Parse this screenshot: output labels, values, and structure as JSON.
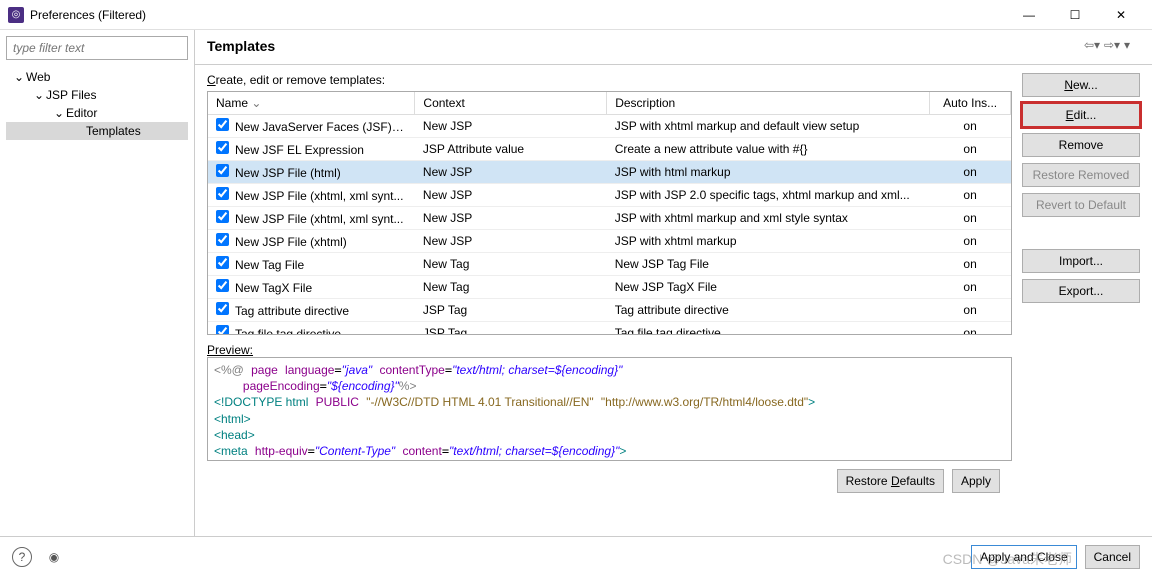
{
  "window": {
    "title": "Preferences (Filtered)"
  },
  "filter": {
    "placeholder": "type filter text"
  },
  "tree": {
    "items": [
      {
        "label": "Web",
        "level": 1,
        "caret": "⌄",
        "selected": false
      },
      {
        "label": "JSP Files",
        "level": 2,
        "caret": "⌄",
        "selected": false
      },
      {
        "label": "Editor",
        "level": 3,
        "caret": "⌄",
        "selected": false
      },
      {
        "label": "Templates",
        "level": 4,
        "caret": "",
        "selected": true
      }
    ]
  },
  "page": {
    "title": "Templates",
    "desc_prefix": "C",
    "desc_rest": "reate, edit or remove templates:"
  },
  "table": {
    "headers": {
      "name": "Name",
      "context": "Context",
      "description": "Description",
      "auto": "Auto Ins..."
    },
    "rows": [
      {
        "checked": true,
        "name": "New JavaServer Faces (JSF) P...",
        "context": "New JSP",
        "description": "JSP with xhtml markup and default view setup",
        "auto": "on",
        "selected": false
      },
      {
        "checked": true,
        "name": "New JSF EL Expression",
        "context": "JSP Attribute value",
        "description": "Create a new attribute value with #{}",
        "auto": "on",
        "selected": false
      },
      {
        "checked": true,
        "name": "New JSP File (html)",
        "context": "New JSP",
        "description": "JSP with html markup",
        "auto": "on",
        "selected": true
      },
      {
        "checked": true,
        "name": "New JSP File (xhtml, xml synt...",
        "context": "New JSP",
        "description": "JSP with JSP 2.0 specific tags, xhtml markup and xml...",
        "auto": "on",
        "selected": false
      },
      {
        "checked": true,
        "name": "New JSP File (xhtml, xml synt...",
        "context": "New JSP",
        "description": "JSP with xhtml markup and xml style syntax",
        "auto": "on",
        "selected": false
      },
      {
        "checked": true,
        "name": "New JSP File (xhtml)",
        "context": "New JSP",
        "description": "JSP with xhtml markup",
        "auto": "on",
        "selected": false
      },
      {
        "checked": true,
        "name": "New Tag File",
        "context": "New Tag",
        "description": "New JSP Tag File",
        "auto": "on",
        "selected": false
      },
      {
        "checked": true,
        "name": "New TagX File",
        "context": "New Tag",
        "description": "New JSP TagX File",
        "auto": "on",
        "selected": false
      },
      {
        "checked": true,
        "name": "Tag attribute directive",
        "context": "JSP Tag",
        "description": "Tag attribute directive",
        "auto": "on",
        "selected": false
      },
      {
        "checked": true,
        "name": "Tag file tag directive",
        "context": "JSP Tag",
        "description": "Tag file tag directive",
        "auto": "on",
        "selected": false
      }
    ]
  },
  "preview": {
    "label": "Preview:"
  },
  "buttons": {
    "new": "New...",
    "edit": "Edit...",
    "remove": "Remove",
    "restore_removed": "Restore Removed",
    "revert_default": "Revert to Default",
    "import": "Import...",
    "export": "Export...",
    "restore_defaults": "Restore Defaults",
    "apply": "Apply",
    "apply_close": "Apply and Close",
    "cancel": "Cancel"
  },
  "watermark": "CSDN @Java朱老师"
}
